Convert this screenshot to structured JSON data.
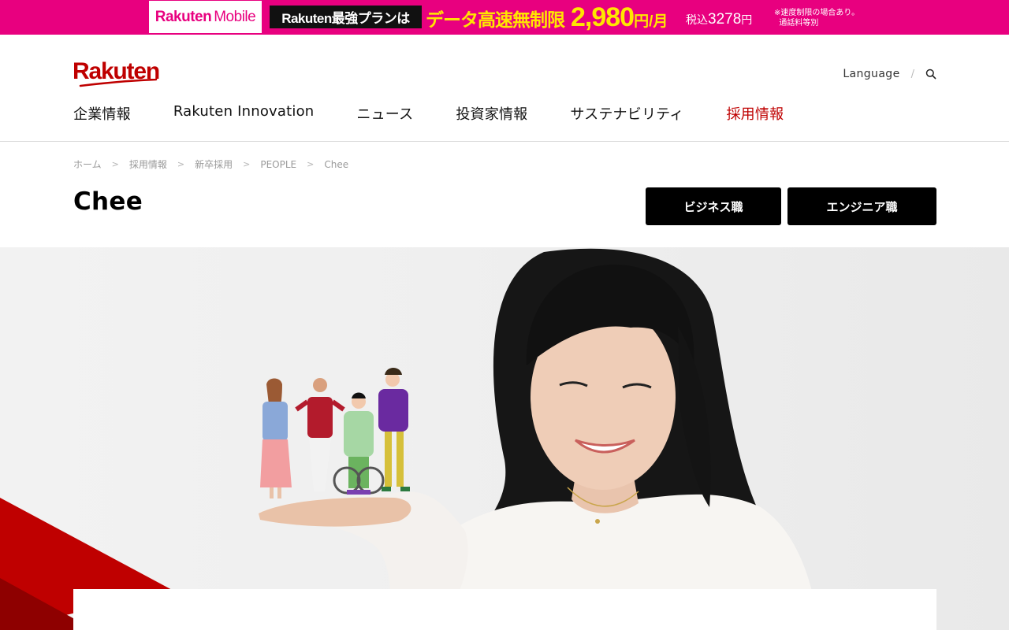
{
  "promo": {
    "brand_bold": "Rakuten",
    "brand_thin": "Mobile",
    "plan": "Rakuten最強プランは",
    "headline": "データ高速無制限",
    "price": "2,980",
    "price_unit": "円/月",
    "tax_label": "税込",
    "tax_price": "3278",
    "tax_unit": "円",
    "note": "※速度制限の場合あり。\n  通話料等別",
    "colors": {
      "background": "#e8007f",
      "highlight": "#ffe600"
    }
  },
  "header": {
    "logo": "Rakuten",
    "logo_color": "#bf0000",
    "language": "Language",
    "separator": "/",
    "search_icon": "search-icon",
    "nav": [
      {
        "label": "企業情報",
        "active": false
      },
      {
        "label": "Rakuten Innovation",
        "active": false
      },
      {
        "label": "ニュース",
        "active": false
      },
      {
        "label": "投資家情報",
        "active": false
      },
      {
        "label": "サステナビリティ",
        "active": false
      },
      {
        "label": "採用情報",
        "active": true
      }
    ]
  },
  "breadcrumb": [
    "ホーム",
    "採用情報",
    "新卒採用",
    "PEOPLE",
    "Chee"
  ],
  "page": {
    "title": "Chee",
    "buttons": {
      "business": "ビジネス職",
      "engineer": "エンジニア職"
    }
  },
  "hero": {
    "image": "portrait-holding-people-illustration",
    "accent_color": "#bf0000"
  }
}
